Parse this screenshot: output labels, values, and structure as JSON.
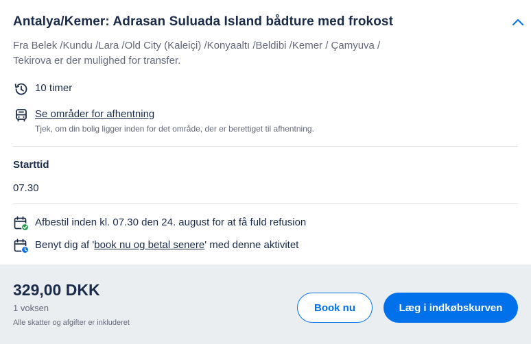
{
  "activity": {
    "title": "Antalya/Kemer: Adrasan Suluada Island bådture med frokost",
    "pickup_description": "Fra Belek /Kundu /Lara /Old City (Kaleiçi) /Konyaaltı /Beldibi /Kemer / Çamyuva / Tekirova er der mulighed for transfer.",
    "duration": "10 timer",
    "pickup_link": "Se områder for afhentning",
    "pickup_note": "Tjek, om din bolig ligger inden for det område, der er berettiget til afhentning.",
    "start_time_label": "Starttid",
    "start_time_value": "07.30",
    "cancellation": "Afbestil inden kl. 07.30 den 24. august for at få fuld refusion",
    "reserve_prefix": "Benyt dig af '",
    "reserve_link": "book nu og betal senere",
    "reserve_suffix": "' med denne aktivitet"
  },
  "footer": {
    "price": "329,00 DKK",
    "travelers": "1 voksen",
    "taxes_note": "Alle skatter og afgifter er inkluderet",
    "book_now_label": "Book nu",
    "add_to_cart_label": "Læg i indkøbskurven"
  },
  "icons": {
    "collapse": "chevron-up-icon",
    "duration": "history-clock-icon",
    "pickup": "bus-icon",
    "cancellation": "calendar-check-icon",
    "reserve": "calendar-clock-icon"
  },
  "colors": {
    "primary": "#0071eb",
    "text": "#1a2b49",
    "muted": "#63687a",
    "footer_bg": "#ebeef1",
    "check_green": "#1a9c4a"
  }
}
